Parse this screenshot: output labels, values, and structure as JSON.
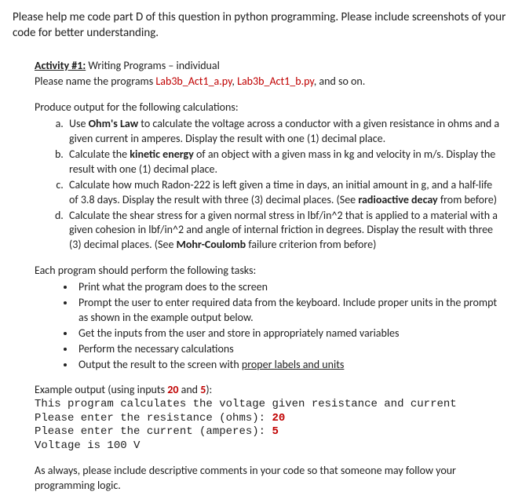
{
  "intro": "Please help me code part D of this question in python programming. Please include screenshots of your code for better understanding.",
  "activity": {
    "prefix": "Activity #1:",
    "title_rest": " Writing Programs – individual",
    "naming_lead": "Please name the programs ",
    "file_a": "Lab3b_Act1_a.py",
    "file_sep": ", ",
    "file_b": "Lab3b_Act1_b.py",
    "naming_tail": ", and so on."
  },
  "calc_intro": "Produce output for the following calculations:",
  "items": {
    "a": {
      "pre": "Use ",
      "bold": "Ohm's Law",
      "post": " to calculate the voltage across a conductor with a given resistance in ohms and a given current in amperes. Display the result with one (1) decimal place."
    },
    "b": {
      "pre": "Calculate the ",
      "bold": "kinetic energy",
      "post": " of an object with a given mass in kg and velocity in m/s. Display the result with one (1) decimal place."
    },
    "c": {
      "pre": "Calculate how much Radon-222 is left given a time in days, an initial amount in g, and a half-life of 3.8 days. Display the result with three (3) decimal places. (See ",
      "bold": "radioactive decay",
      "post": " from before)"
    },
    "d": {
      "pre": "Calculate the shear stress for a given normal stress in lbf/in^2 that is applied to a material with a given cohesion in lbf/in^2 and angle of internal friction in degrees. Display the result with three (3) decimal places. (See ",
      "bold": "Mohr-Coulomb",
      "post": " failure criterion from before)"
    }
  },
  "tasks_intro": "Each program should perform the following tasks:",
  "tasks": {
    "t1": "Print what the program does to the screen",
    "t2": "Prompt the user to enter required data from the keyboard. Include proper units in the prompt as shown in the example output below.",
    "t3": "Get the inputs from the user and store in appropriately named variables",
    "t4": "Perform the necessary calculations",
    "t5_pre": "Output the result to the screen with ",
    "t5_ul": "proper labels and units"
  },
  "example": {
    "lead_pre": "Example output (using inputs ",
    "in1": "20",
    "lead_mid": " and ",
    "in2": "5",
    "lead_post": "):",
    "line1": "This program calculates the voltage given resistance and current",
    "line2_pre": "Please enter the resistance (ohms): ",
    "line2_val": "20",
    "line3_pre": "Please enter the current (amperes): ",
    "line3_val": "5",
    "line4": "Voltage is 100 V"
  },
  "closing": "As always, please include descriptive comments in your code so that someone may follow your programming logic."
}
